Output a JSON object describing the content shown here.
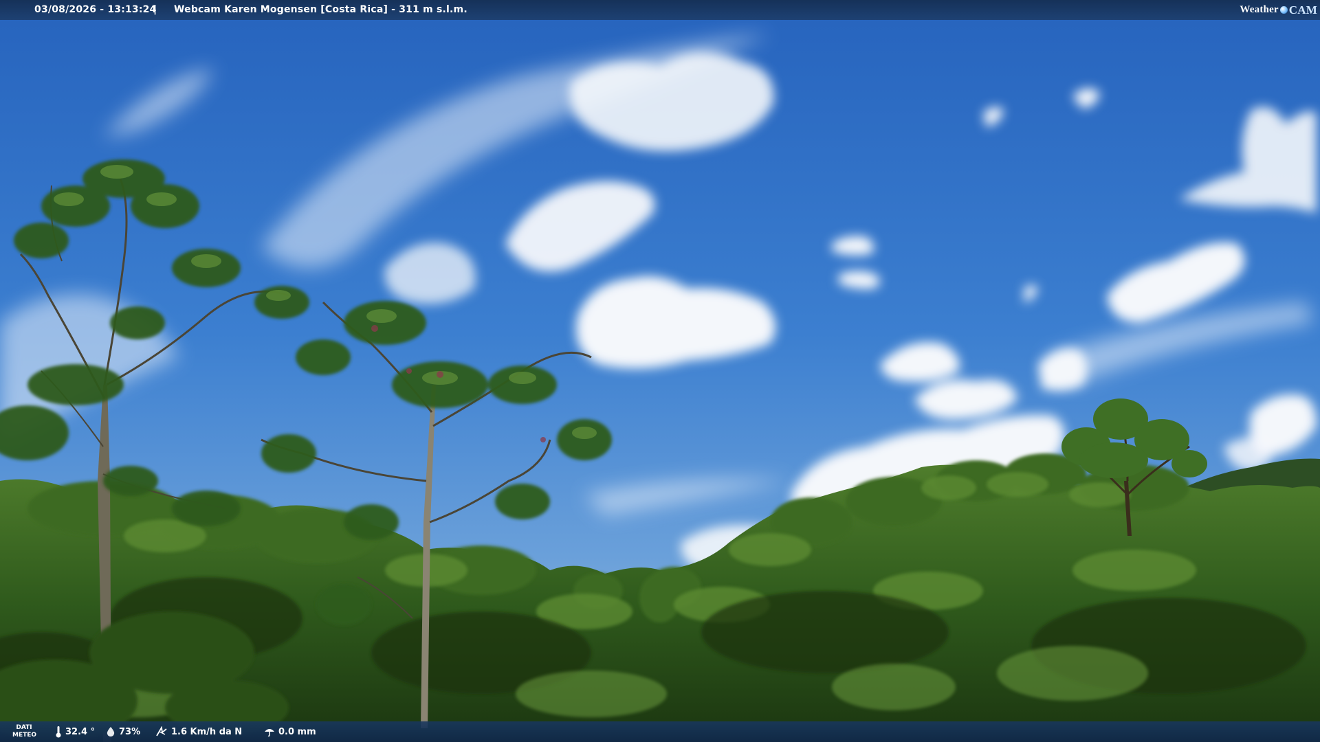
{
  "header": {
    "datetime": "03/08/2026 - 13:13:24",
    "separator": "|",
    "title": "Webcam Karen Mogensen [Costa Rica] - 311 m s.l.m.",
    "logo_weather": "Weather",
    "logo_cam": "CAM"
  },
  "footer": {
    "dati_line1": "DATI",
    "dati_line2": "METEO",
    "temperature": "32.4 °",
    "humidity": "73%",
    "wind": "1.6 Km/h da N",
    "rain": "0.0 mm"
  },
  "icons": {
    "temperature": "thermometer-icon",
    "humidity": "water-drop-icon",
    "wind": "wind-icon",
    "rain": "umbrella-icon",
    "logo": "globe-icon"
  },
  "colors": {
    "sky_top": "#2a6cc4",
    "sky_bottom": "#8fb8e0",
    "foliage_dark": "#1f3a14",
    "foliage_mid": "#3d6b22",
    "foliage_light": "#6f9a3a",
    "overlay_bar": "#1c3c69"
  }
}
